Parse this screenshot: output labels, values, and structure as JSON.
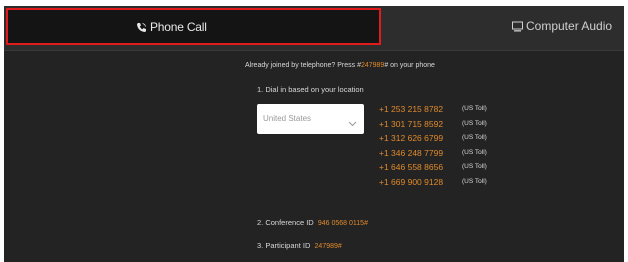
{
  "tabs": {
    "phone_call": {
      "label": "Phone Call",
      "icon": "phone-icon",
      "selected": true
    },
    "computer_audio": {
      "label": "Computer Audio",
      "icon": "computer-audio-icon"
    }
  },
  "content": {
    "already_joined_prefix": "Already joined by telephone? Press #",
    "already_joined_code": "247989",
    "already_joined_suffix": "# on your phone",
    "step1_label": "1. Dial in based on your location",
    "country_select": {
      "value": "United States"
    },
    "phone_numbers": [
      {
        "number": "+1 253 215 8782",
        "toll": "(US Toll)"
      },
      {
        "number": "+1 301 715 8592",
        "toll": "(US Toll)"
      },
      {
        "number": "+1 312 626 6799",
        "toll": "(US Toll)"
      },
      {
        "number": "+1 346 248 7799",
        "toll": "(US Toll)"
      },
      {
        "number": "+1 646 558 8656",
        "toll": "(US Toll)"
      },
      {
        "number": "+1 669 900 9128",
        "toll": "(US Toll)"
      }
    ],
    "step2_label": "2. Conference ID",
    "conference_id": "946 0568 0115#",
    "step3_label": "3. Participant ID",
    "participant_id": "247989#"
  },
  "colors": {
    "accent": "#e08a2c",
    "highlight_border": "#e01b1b",
    "background": "#232323"
  }
}
